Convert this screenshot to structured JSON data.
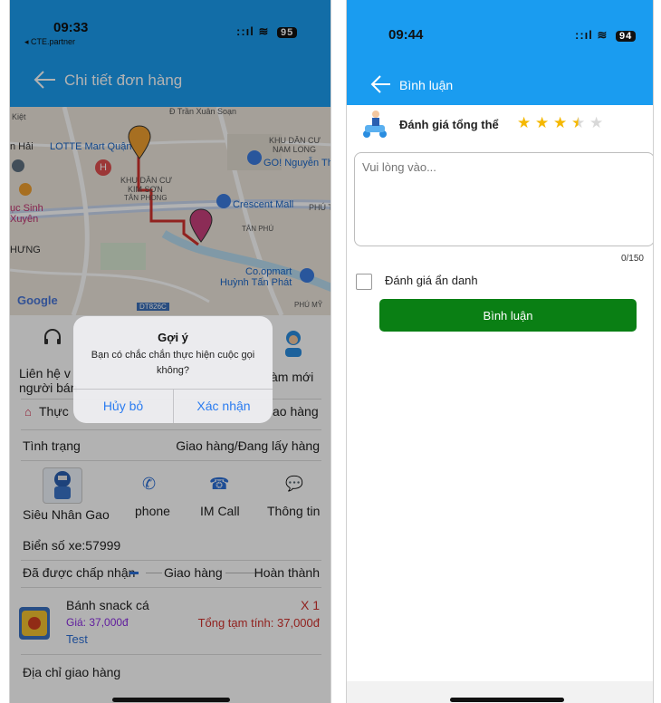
{
  "left": {
    "status": {
      "time": "09:33",
      "back_app": "◂ CTE.partner",
      "signal": "::ıl",
      "wifi": "≋",
      "battery": "95"
    },
    "header": {
      "title": "Chi tiết đơn hàng"
    },
    "map": {
      "labels": [
        "Ð Trần Xuân Soạn",
        "Kiệt",
        "n Hải",
        "LOTTE Mart Quận",
        "KHU DÂN CƯ",
        "NAM LONG",
        "GO! Nguyễn Thị",
        "KHU DÂN CƯ",
        "KIM SƠN",
        "TÂN PHONG",
        "Crescent Mall",
        "PHÚ TH",
        "TÂN PHÚ",
        "ục Sinh",
        "Xuyên",
        "HƯNG",
        "Co.opmart",
        "Huỳnh Tấn Phát",
        "PHÚ MỸ",
        "DT826C"
      ],
      "google": "Google"
    },
    "contact": {
      "line1": "Liên hệ v",
      "line2": "người bán",
      "new_line": "àm mới"
    },
    "category": {
      "label": "Thực",
      "right": "ao hàng"
    },
    "status_row": {
      "label": "Tình trạng",
      "value": "Giao hàng/Đang lấy hàng"
    },
    "driver": {
      "name": "Siêu Nhân Gao",
      "phone": "phone",
      "im_call": "IM Call",
      "info": "Thông tin"
    },
    "plate": "Biển số xe:57999",
    "progress": {
      "step1": "Đã được chấp nhận",
      "step2": "Giao hàng",
      "step3": "Hoàn thành"
    },
    "product": {
      "name": "Bánh snack cá",
      "qty": "X 1",
      "price": "Giá: 37,000đ",
      "subtotal": "Tổng tạm tính: 37,000đ",
      "note": "Test"
    },
    "address": "Địa chỉ giao hàng",
    "dialog": {
      "title": "Gợi ý",
      "message": "Bạn có chắc chắn thực hiện cuộc gọi không?",
      "cancel": "Hủy bỏ",
      "confirm": "Xác nhận"
    }
  },
  "right": {
    "status": {
      "time": "09:44",
      "signal": "::ıl",
      "wifi": "≋",
      "battery": "94"
    },
    "header": {
      "title": "Bình luận"
    },
    "rating": {
      "label": "Đánh giá tổng thể",
      "value": 3.5,
      "max": 5
    },
    "comment": {
      "placeholder": "Vui lòng vào...",
      "counter": "0/150"
    },
    "anonymous_label": "Đánh giá ẩn danh",
    "submit_label": "Bình luận"
  },
  "colors": {
    "header": "#1a9cf0",
    "submit": "#0a7f14",
    "star": "#f5b800",
    "route": "#d0312d",
    "accent_blue": "#2c6fd6"
  }
}
